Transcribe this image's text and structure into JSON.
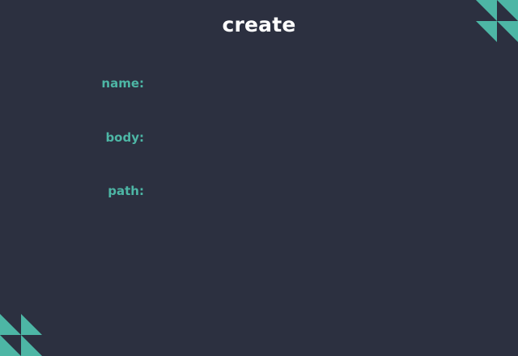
{
  "page": {
    "title": "create"
  },
  "form": {
    "fields": [
      {
        "label": "name:",
        "value": ""
      },
      {
        "label": "body:",
        "value": ""
      },
      {
        "label": "path:",
        "value": ""
      }
    ]
  },
  "theme": {
    "background": "#2c3040",
    "accent": "#4db6a5",
    "title_color": "#ffffff"
  },
  "decorations": {
    "top_right_icon": "teal-triangle-pattern-icon",
    "bottom_left_icon": "teal-triangle-pattern-icon"
  }
}
